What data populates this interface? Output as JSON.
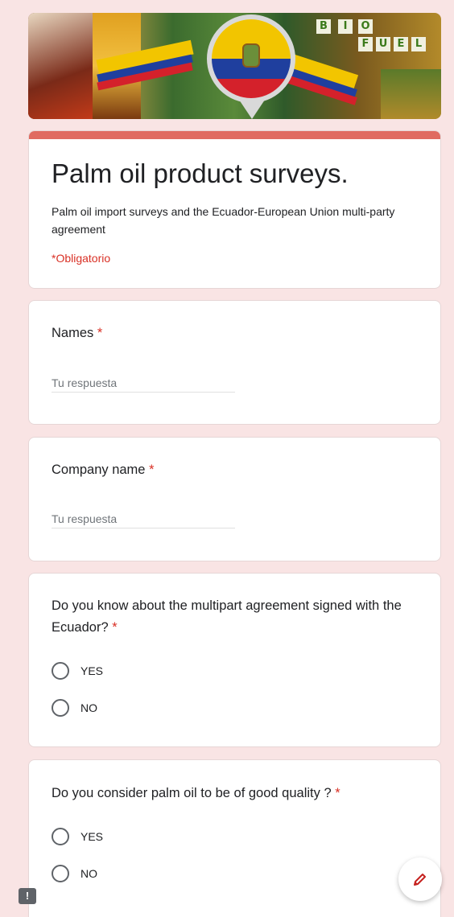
{
  "header": {
    "banner_letters_top": [
      "B",
      "I",
      "O"
    ],
    "banner_letters_bottom": [
      "F",
      "U",
      "E",
      "L"
    ]
  },
  "form": {
    "title": "Palm oil product surveys.",
    "description": "Palm oil import surveys and the Ecuador-European Union multi-party agreement",
    "required_note": "*Obligatorio"
  },
  "questions": [
    {
      "title": "Names",
      "required_mark": "*",
      "placeholder": "Tu respuesta"
    },
    {
      "title": "Company name",
      "required_mark": "*",
      "placeholder": "Tu respuesta"
    },
    {
      "title": "Do you know about the multipart agreement signed with the Ecuador?",
      "required_mark": "*",
      "options": [
        "YES",
        "NO"
      ]
    },
    {
      "title": "Do you consider palm oil to be of good quality ?",
      "required_mark": "*",
      "options": [
        "YES",
        "NO"
      ]
    }
  ],
  "icons": {
    "fab": "pencil-icon",
    "feedback": "report-feedback-icon"
  },
  "colors": {
    "background": "#f9e4e4",
    "accent": "#e06b61",
    "required": "#d93025"
  }
}
